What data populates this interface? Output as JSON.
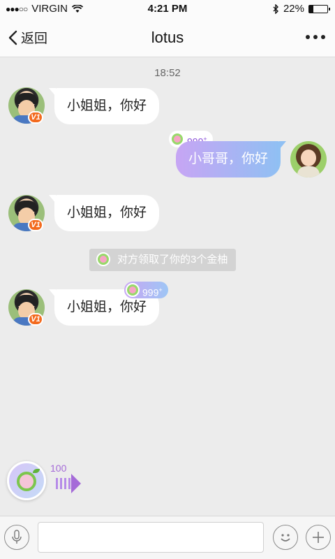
{
  "status_bar": {
    "carrier": "VIRGIN",
    "time": "4:21 PM",
    "battery": "22%",
    "battery_level": 0.22
  },
  "nav": {
    "back_label": "返回",
    "title": "lotus"
  },
  "chat": {
    "timestamp": "18:52",
    "messages": [
      {
        "side": "left",
        "text": "小姐姐，你好",
        "vip": "V1"
      },
      {
        "side": "right",
        "text": "小哥哥，你好",
        "badge": "999",
        "badge_sup": "+"
      },
      {
        "side": "left",
        "text": "小姐姐，你好",
        "vip": "V1"
      },
      {
        "side": "left",
        "text": "小姐姐，你好",
        "vip": "V1",
        "badge": "999",
        "badge_sup": "+"
      }
    ],
    "system_notice": "对方领取了你的3个金柚"
  },
  "floating": {
    "count": "100"
  },
  "input": {
    "placeholder": ""
  },
  "colors": {
    "bubble_gradient_start": "#c7a5f4",
    "bubble_gradient_end": "#8fc0f3",
    "vip_badge": "#f36a1e",
    "pomelo_count": "#a56bd8"
  }
}
